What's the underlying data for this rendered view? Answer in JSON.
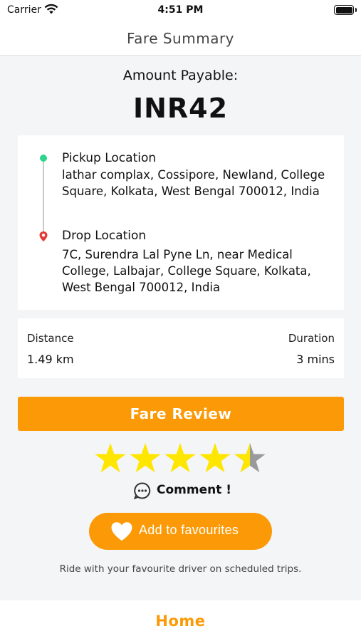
{
  "status_bar": {
    "carrier": "Carrier",
    "time": "4:51 PM"
  },
  "nav": {
    "title": "Fare Summary"
  },
  "fare": {
    "amount_label": "Amount Payable:",
    "amount": "INR42"
  },
  "route": {
    "pickup_title": "Pickup Location",
    "pickup_address": "lathar complax, Cossipore, Newland, College Square, Kolkata, West Bengal 700012, India",
    "drop_title": "Drop Location",
    "drop_address": "7C, Surendra Lal Pyne Ln, near Medical College, Lalbajar, College Square, Kolkata, West Bengal 700012, India"
  },
  "trip": {
    "distance_label": "Distance",
    "distance_value": "1.49 km",
    "duration_label": "Duration",
    "duration_value": "3 mins"
  },
  "actions": {
    "fare_review_label": "Fare Review",
    "rating": 4.5,
    "rating_max": 5,
    "comment_label": "Comment !",
    "favourite_label": "Add to favourites",
    "favourite_hint": "Ride with your favourite driver on scheduled trips."
  },
  "footer": {
    "home_label": "Home"
  },
  "colors": {
    "accent": "#fb9a06",
    "star": "#ffe600",
    "star_empty": "#9a9a9a",
    "pickup_dot": "#2fd48a",
    "drop_pin": "#e53935"
  },
  "icons": [
    "wifi-icon",
    "battery-icon",
    "pickup-dot-icon",
    "drop-pin-icon",
    "star-icon",
    "comment-icon",
    "heart-icon"
  ]
}
